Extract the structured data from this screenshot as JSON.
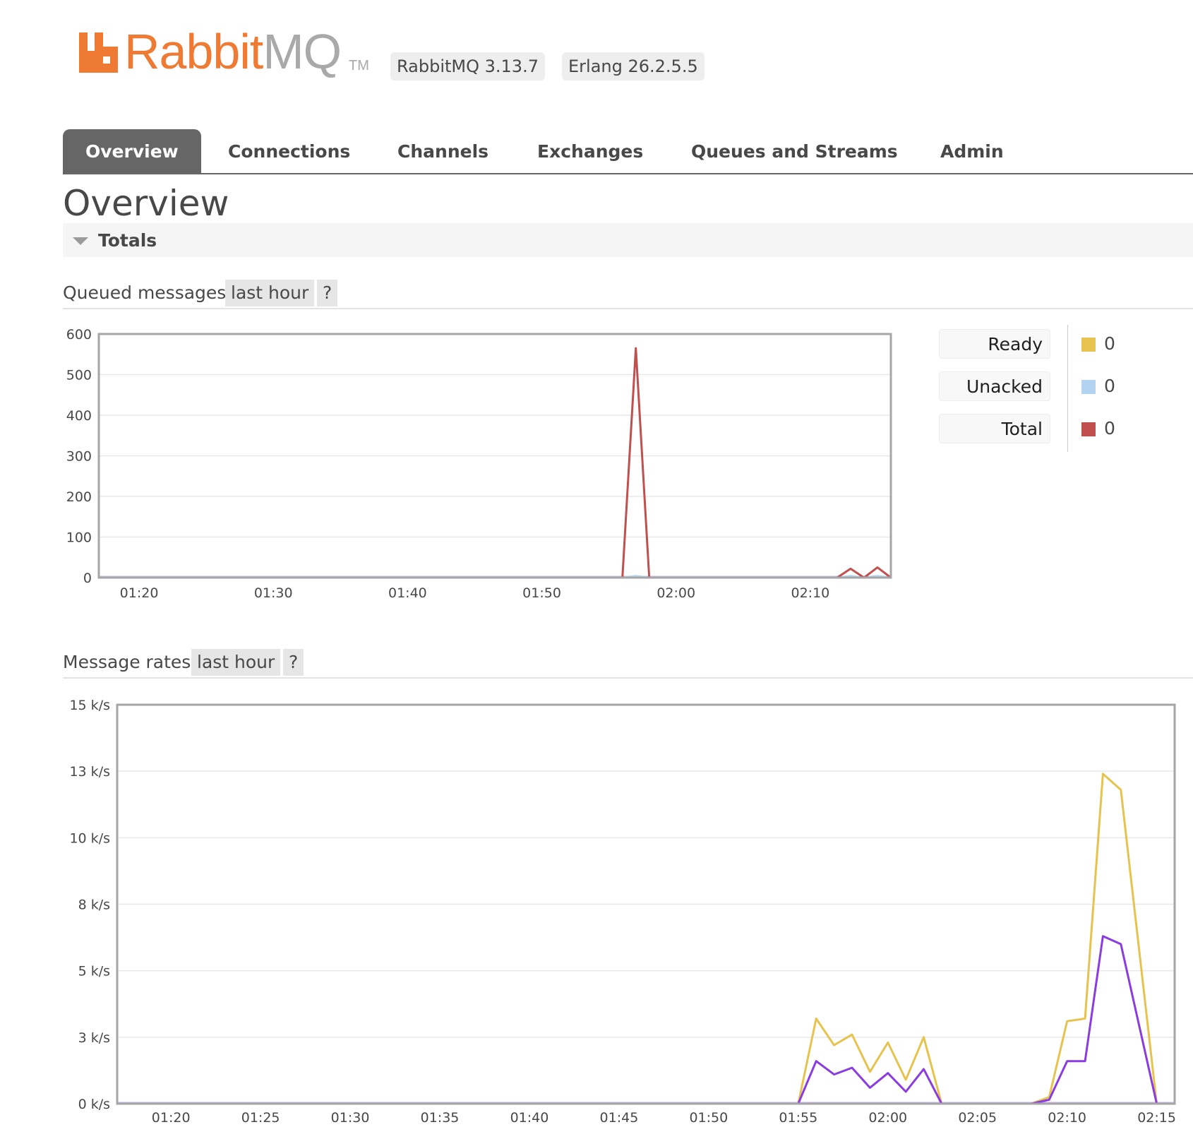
{
  "header": {
    "logo_word_rabbit": "Rabbit",
    "logo_word_mq": "MQ",
    "logo_tm": "TM",
    "version_badge": "RabbitMQ 3.13.7",
    "erlang_badge": "Erlang 26.2.5.5",
    "colors": {
      "brand_orange": "#ee7a33",
      "logo_grey": "#a9a9a9"
    }
  },
  "nav": {
    "tabs": [
      {
        "label": "Overview",
        "active": true
      },
      {
        "label": "Connections",
        "active": false
      },
      {
        "label": "Channels",
        "active": false
      },
      {
        "label": "Exchanges",
        "active": false
      },
      {
        "label": "Queues and Streams",
        "active": false
      },
      {
        "label": "Admin",
        "active": false
      }
    ]
  },
  "page": {
    "title": "Overview",
    "section_label": "Totals",
    "section_icon": "triangle-down-icon"
  },
  "queued_messages": {
    "title": "Queued messages",
    "range_label": "last hour",
    "help_label": "?",
    "legend": [
      {
        "label": "Ready",
        "value": "0",
        "color": "#e6c34f"
      },
      {
        "label": "Unacked",
        "value": "0",
        "color": "#b3d4f0"
      },
      {
        "label": "Total",
        "value": "0",
        "color": "#c0504d"
      }
    ]
  },
  "message_rates": {
    "title": "Message rates",
    "range_label": "last hour",
    "help_label": "?"
  },
  "chart_data": [
    {
      "type": "line",
      "title": "Queued messages",
      "xlabel": "",
      "ylabel": "",
      "x_ticks": [
        "01:20",
        "01:30",
        "01:40",
        "01:50",
        "02:00",
        "02:10"
      ],
      "y_ticks": [
        "0",
        "100",
        "200",
        "300",
        "400",
        "500",
        "600"
      ],
      "ylim": [
        0,
        600
      ],
      "xlim_minutes": [
        "01:17",
        "02:16"
      ],
      "grid": true,
      "series": [
        {
          "color": "#c0504d",
          "x": [
            "01:17",
            "01:56",
            "01:57",
            "01:58",
            "02:12",
            "02:13",
            "02:14",
            "02:15",
            "02:16"
          ],
          "values": [
            0,
            0,
            565,
            0,
            0,
            22,
            0,
            25,
            0
          ]
        },
        {
          "color": "#b3d4f0",
          "x": [
            "01:17",
            "01:56",
            "01:57",
            "01:58",
            "02:12",
            "02:13",
            "02:14",
            "02:15",
            "02:16"
          ],
          "values": [
            0,
            0,
            4,
            0,
            0,
            4,
            0,
            4,
            0
          ]
        }
      ]
    },
    {
      "type": "line",
      "title": "Message rates",
      "xlabel": "",
      "ylabel": "",
      "x_ticks": [
        "01:20",
        "01:25",
        "01:30",
        "01:35",
        "01:40",
        "01:45",
        "01:50",
        "01:55",
        "02:00",
        "02:05",
        "02:10",
        "02:15"
      ],
      "y_ticks": [
        "0 k/s",
        "3 k/s",
        "5 k/s",
        "8 k/s",
        "10 k/s",
        "13 k/s",
        "15 k/s"
      ],
      "ylim_kps": [
        0,
        15
      ],
      "xlim_minutes": [
        "01:17",
        "02:16"
      ],
      "grid": true,
      "series": [
        {
          "color": "#e6c34f",
          "x": [
            "01:17",
            "01:55",
            "01:56",
            "01:57",
            "01:58",
            "01:59",
            "02:00",
            "02:01",
            "02:02",
            "02:03",
            "02:08",
            "02:09",
            "02:10",
            "02:11",
            "02:12",
            "02:13",
            "02:15"
          ],
          "values": [
            0,
            0,
            3.2,
            2.2,
            2.6,
            1.2,
            2.3,
            0.9,
            2.5,
            0,
            0,
            0.25,
            3.1,
            3.2,
            12.4,
            11.8,
            0
          ]
        },
        {
          "color": "#8a3ce0",
          "x": [
            "01:17",
            "01:55",
            "01:56",
            "01:57",
            "01:58",
            "01:59",
            "02:00",
            "02:01",
            "02:02",
            "02:03",
            "02:08",
            "02:09",
            "02:10",
            "02:11",
            "02:12",
            "02:13",
            "02:15"
          ],
          "values": [
            0,
            0,
            1.6,
            1.1,
            1.35,
            0.6,
            1.15,
            0.45,
            1.3,
            0,
            0,
            0.15,
            1.6,
            1.6,
            6.3,
            6.0,
            0
          ]
        }
      ]
    }
  ]
}
